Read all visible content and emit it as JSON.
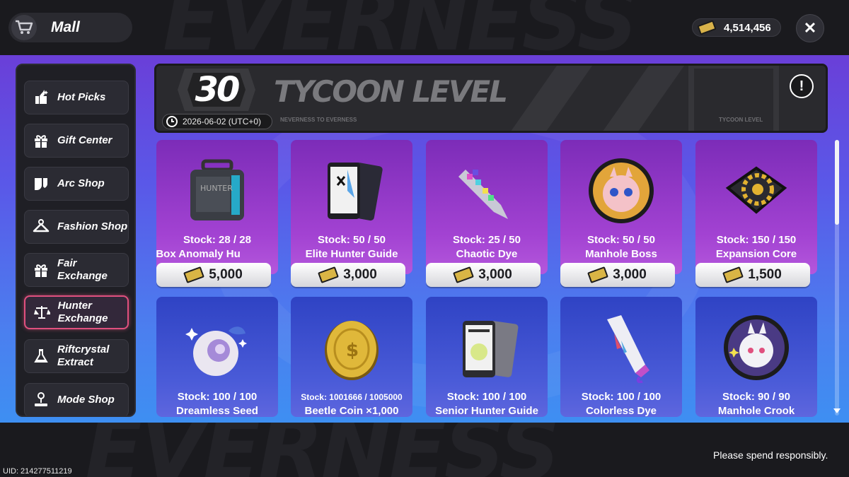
{
  "header": {
    "title": "Mall",
    "currency_value": "4,514,456",
    "close_label": "✕"
  },
  "sidebar": {
    "items": [
      {
        "label": "Hot Picks",
        "icon": "hot-picks-icon"
      },
      {
        "label": "Gift Center",
        "icon": "gift-icon"
      },
      {
        "label": "Arc Shop",
        "icon": "arc-icon"
      },
      {
        "label": "Fashion Shop",
        "icon": "hanger-icon"
      },
      {
        "label": "Fair Exchange",
        "icon": "gift-exchange-icon"
      },
      {
        "label": "Hunter Exchange",
        "icon": "scales-icon",
        "active": true
      },
      {
        "label": "Riftcrystal Extract",
        "icon": "flask-icon"
      },
      {
        "label": "Mode Shop",
        "icon": "person-pin-icon"
      }
    ]
  },
  "banner": {
    "level": "30",
    "title": "TYCOON LEVEL",
    "date": "2026-06-02 (UTC+0)",
    "small_text_1": "NEVERNESS TO EVERNESS",
    "small_text_2": "TYCOON LEVEL",
    "info_label": "!"
  },
  "items": [
    {
      "name": "Anomaly Hunter Box",
      "name_visible": "n Box      Anomaly Hu",
      "stock": "Stock:  28 / 28",
      "price": "5,000",
      "art": "box-icon"
    },
    {
      "name": "Elite Hunter Guide",
      "stock": "Stock:  50 / 50",
      "price": "3,000",
      "art": "guide-icon"
    },
    {
      "name": "Chaotic Dye",
      "stock": "Stock:  25 / 50",
      "price": "3,000",
      "art": "dye-icon"
    },
    {
      "name": "Manhole Boss",
      "stock": "Stock:  50 / 50",
      "price": "3,000",
      "art": "manhole-icon"
    },
    {
      "name": "Expansion Core",
      "stock": "Stock:  150 / 150",
      "price": "1,500",
      "art": "core-icon"
    },
    {
      "name": "Dreamless Seed",
      "stock": "Stock:  100 / 100",
      "price": "",
      "art": "seed-icon"
    },
    {
      "name": "Beetle Coin ×1,000",
      "stock": "Stock:  1001666 / 1005000",
      "price": "",
      "art": "coin-icon"
    },
    {
      "name": "Senior Hunter Guide",
      "stock": "Stock:  100 / 100",
      "price": "",
      "art": "guide-icon"
    },
    {
      "name": "Colorless Dye",
      "stock": "Stock:  100 / 100",
      "price": "",
      "art": "tube-icon"
    },
    {
      "name": "Manhole Crook",
      "stock": "Stock:  90 / 90",
      "price": "",
      "art": "manhole-icon"
    }
  ],
  "footer": {
    "note": "Please spend responsibly.",
    "uid": "UID: 214277511219"
  },
  "colors": {
    "accent_active": "#e0507e",
    "card_row1": "#a242d2",
    "card_row2": "#4a5bd8",
    "ticket": "#d9b545"
  }
}
